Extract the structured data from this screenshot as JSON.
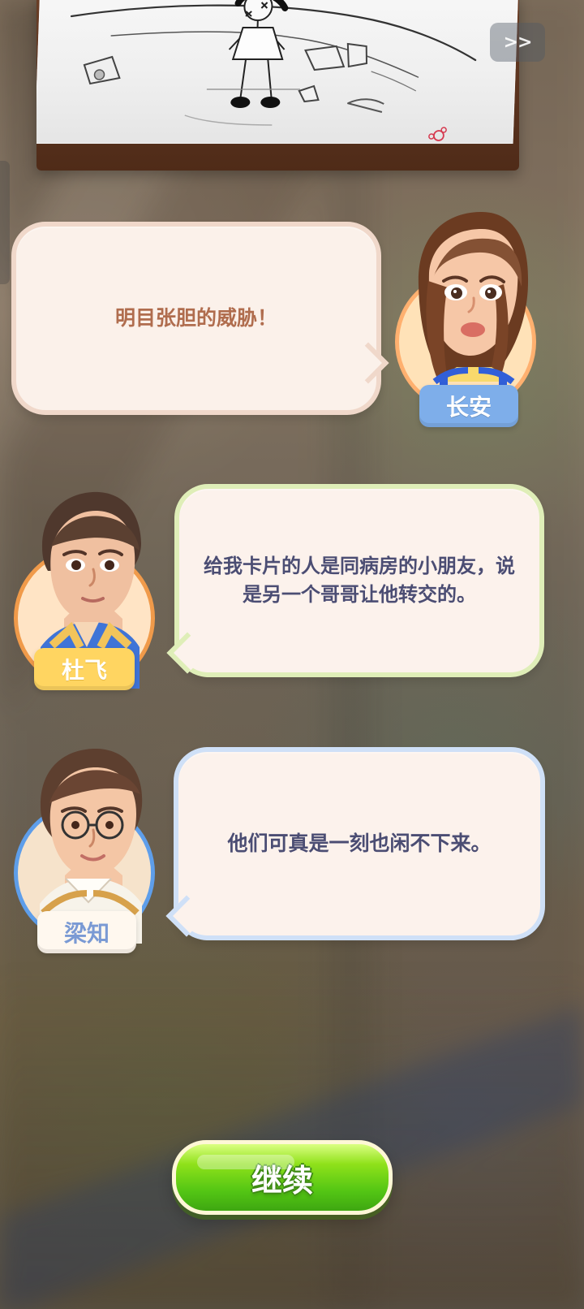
{
  "cutscene": {
    "skip_label": ">>"
  },
  "dialogues": [
    {
      "speaker": "长安",
      "text": "明目张胆的威胁！"
    },
    {
      "speaker": "杜飞",
      "text": "给我卡片的人是同病房的小朋友，说是另一个哥哥让他转交的。"
    },
    {
      "speaker": "梁知",
      "text": "他们可真是一刻也闲不下来。"
    }
  ],
  "actions": {
    "continue_label": "继续"
  },
  "icons": {
    "skip": "fast-forward-icon",
    "continue": "continue-button-icon"
  },
  "colors": {
    "continue_green": "#54c614",
    "speaker_1_ring": "#ffb06f",
    "speaker_2_ring": "#f09a4a",
    "speaker_3_ring": "#5e9eea"
  }
}
